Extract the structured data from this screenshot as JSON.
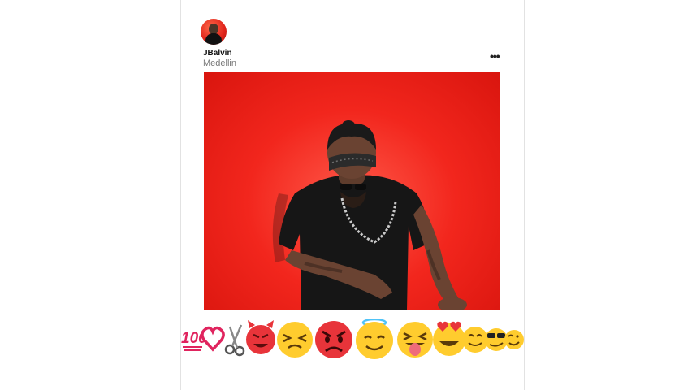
{
  "post": {
    "username": "JBalvin",
    "location": "Medellin",
    "more_icon": "more-horizontal-icon"
  },
  "reactions": [
    {
      "name": "hundred-points-icon",
      "color": "#e0245e"
    },
    {
      "name": "heart-outline-icon",
      "color": "#e0245e"
    },
    {
      "name": "scissors-icon",
      "color": "#555555"
    },
    {
      "name": "smiling-devil-icon",
      "color": "#e8343a"
    },
    {
      "name": "squinting-face-icon",
      "color": "#ffcc2e"
    },
    {
      "name": "angry-face-icon",
      "color": "#e8343a"
    },
    {
      "name": "halo-smile-icon",
      "color": "#ffcc2e"
    },
    {
      "name": "tongue-out-face-icon",
      "color": "#ffcc2e"
    },
    {
      "name": "heart-eyes-face-icon",
      "color": "#ffcc2e"
    },
    {
      "name": "smiling-face-icon",
      "color": "#ffcc2e"
    },
    {
      "name": "sunglasses-face-icon",
      "color": "#ffcc2e"
    },
    {
      "name": "winking-face-icon",
      "color": "#ffcc2e"
    }
  ]
}
